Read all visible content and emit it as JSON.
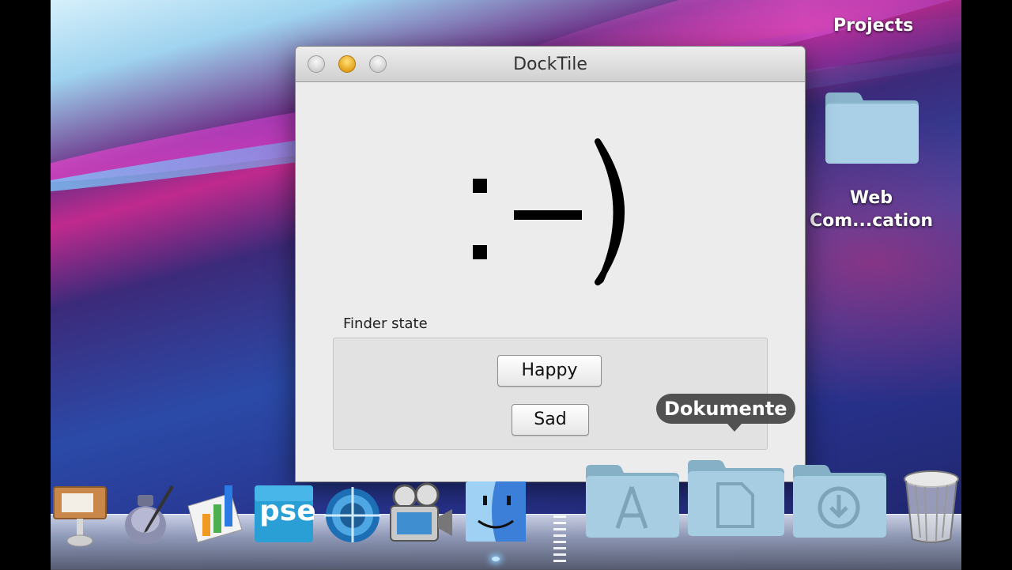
{
  "window": {
    "title": "DockTile",
    "face_text": ":-)",
    "group_label": "Finder state",
    "buttons": {
      "happy": "Happy",
      "sad": "Sad"
    }
  },
  "desktop": {
    "projects_label": "Projects",
    "folder_label_line1": "Web",
    "folder_label_line2": "Com...cation"
  },
  "dock": {
    "tooltip": "Dokumente",
    "items": [
      {
        "icon": "keynote-icon"
      },
      {
        "icon": "script-editor-icon"
      },
      {
        "icon": "numbers-icon"
      },
      {
        "icon": "photoshop-elements-icon",
        "text": "pse"
      },
      {
        "icon": "network-utility-icon"
      },
      {
        "icon": "imovie-icon"
      },
      {
        "icon": "finder-icon"
      },
      {
        "icon": "applications-folder-icon"
      },
      {
        "icon": "documents-folder-icon"
      },
      {
        "icon": "downloads-folder-icon"
      },
      {
        "icon": "trash-icon"
      }
    ]
  }
}
